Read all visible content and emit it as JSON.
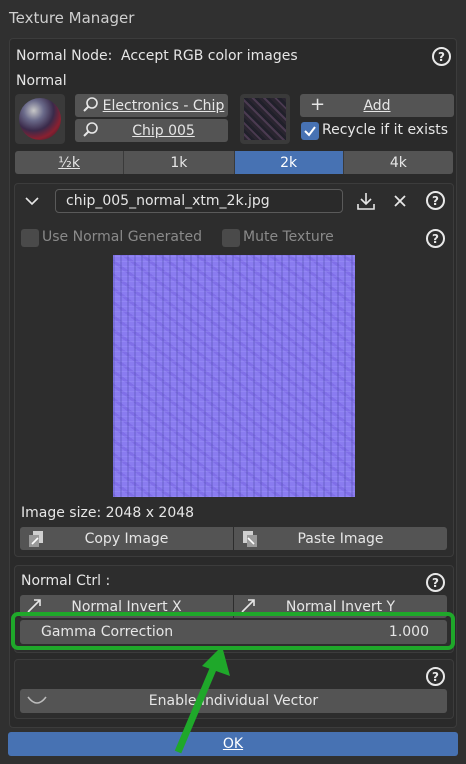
{
  "window": {
    "title": "Texture Manager"
  },
  "header": {
    "node_label": "Normal Node:",
    "node_desc": "Accept RGB color images",
    "section": "Normal"
  },
  "library": {
    "category": "Electronics - Chip",
    "item": "Chip 005",
    "add_label": "Add",
    "recycle_label": "Recycle if it exists",
    "recycle_checked": true
  },
  "resolution": {
    "options": [
      "½k",
      "1k",
      "2k",
      "4k"
    ],
    "selected": "2k"
  },
  "file": {
    "name": "chip_005_normal_xtm_2k.jpg"
  },
  "options": {
    "use_normal_generated": "Use Normal Generated",
    "mute_texture": "Mute Texture"
  },
  "image": {
    "size_text": "Image size: 2048 x 2048",
    "copy_label": "Copy Image",
    "paste_label": "Paste Image"
  },
  "normal_ctrl": {
    "title": "Normal Ctrl :",
    "invert_x": "Normal Invert X",
    "invert_y": "Normal Invert Y",
    "gamma_label": "Gamma Correction",
    "gamma_value": "1.000"
  },
  "vector": {
    "enable_label": "Enable Individual Vector"
  },
  "footer": {
    "ok_label": "OK"
  },
  "colors": {
    "accent": "#4772b3",
    "highlight": "#1fa82a",
    "normal_map": "#8a7cf0"
  }
}
